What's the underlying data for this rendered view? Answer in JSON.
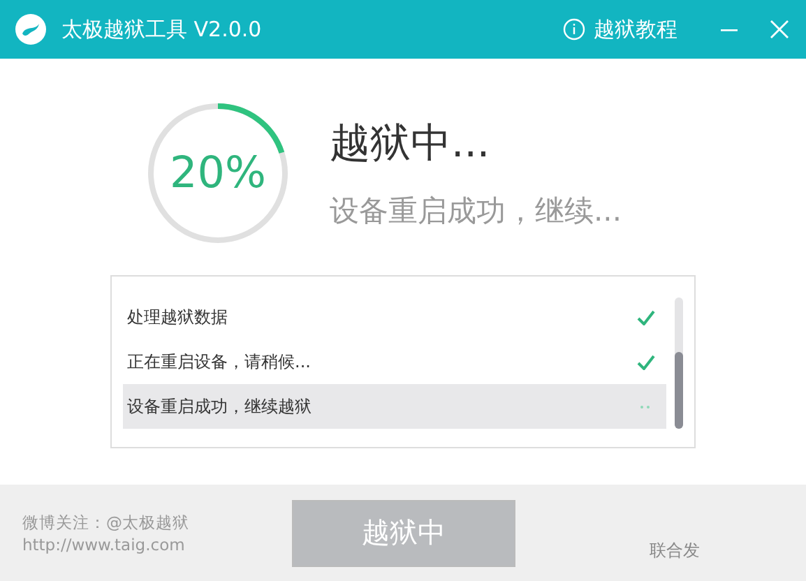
{
  "window": {
    "title": "太极越狱工具 V2.0.0",
    "help_link": "越狱教程"
  },
  "progress": {
    "percent": "20%",
    "title": "越狱中...",
    "message": "设备重启成功，继续..."
  },
  "log": [
    {
      "text": "处理越狱数据",
      "done": true,
      "selected": false
    },
    {
      "text": "正在重启设备，请稍候...",
      "done": true,
      "selected": false
    },
    {
      "text": "设备重启成功，继续越狱",
      "done": false,
      "selected": true
    }
  ],
  "footer": {
    "weibo": "微博关注：@太极越狱",
    "url": "http://www.taig.com",
    "button": {
      "label": "越狱中",
      "disabled": true
    },
    "partner": "联合发"
  }
}
